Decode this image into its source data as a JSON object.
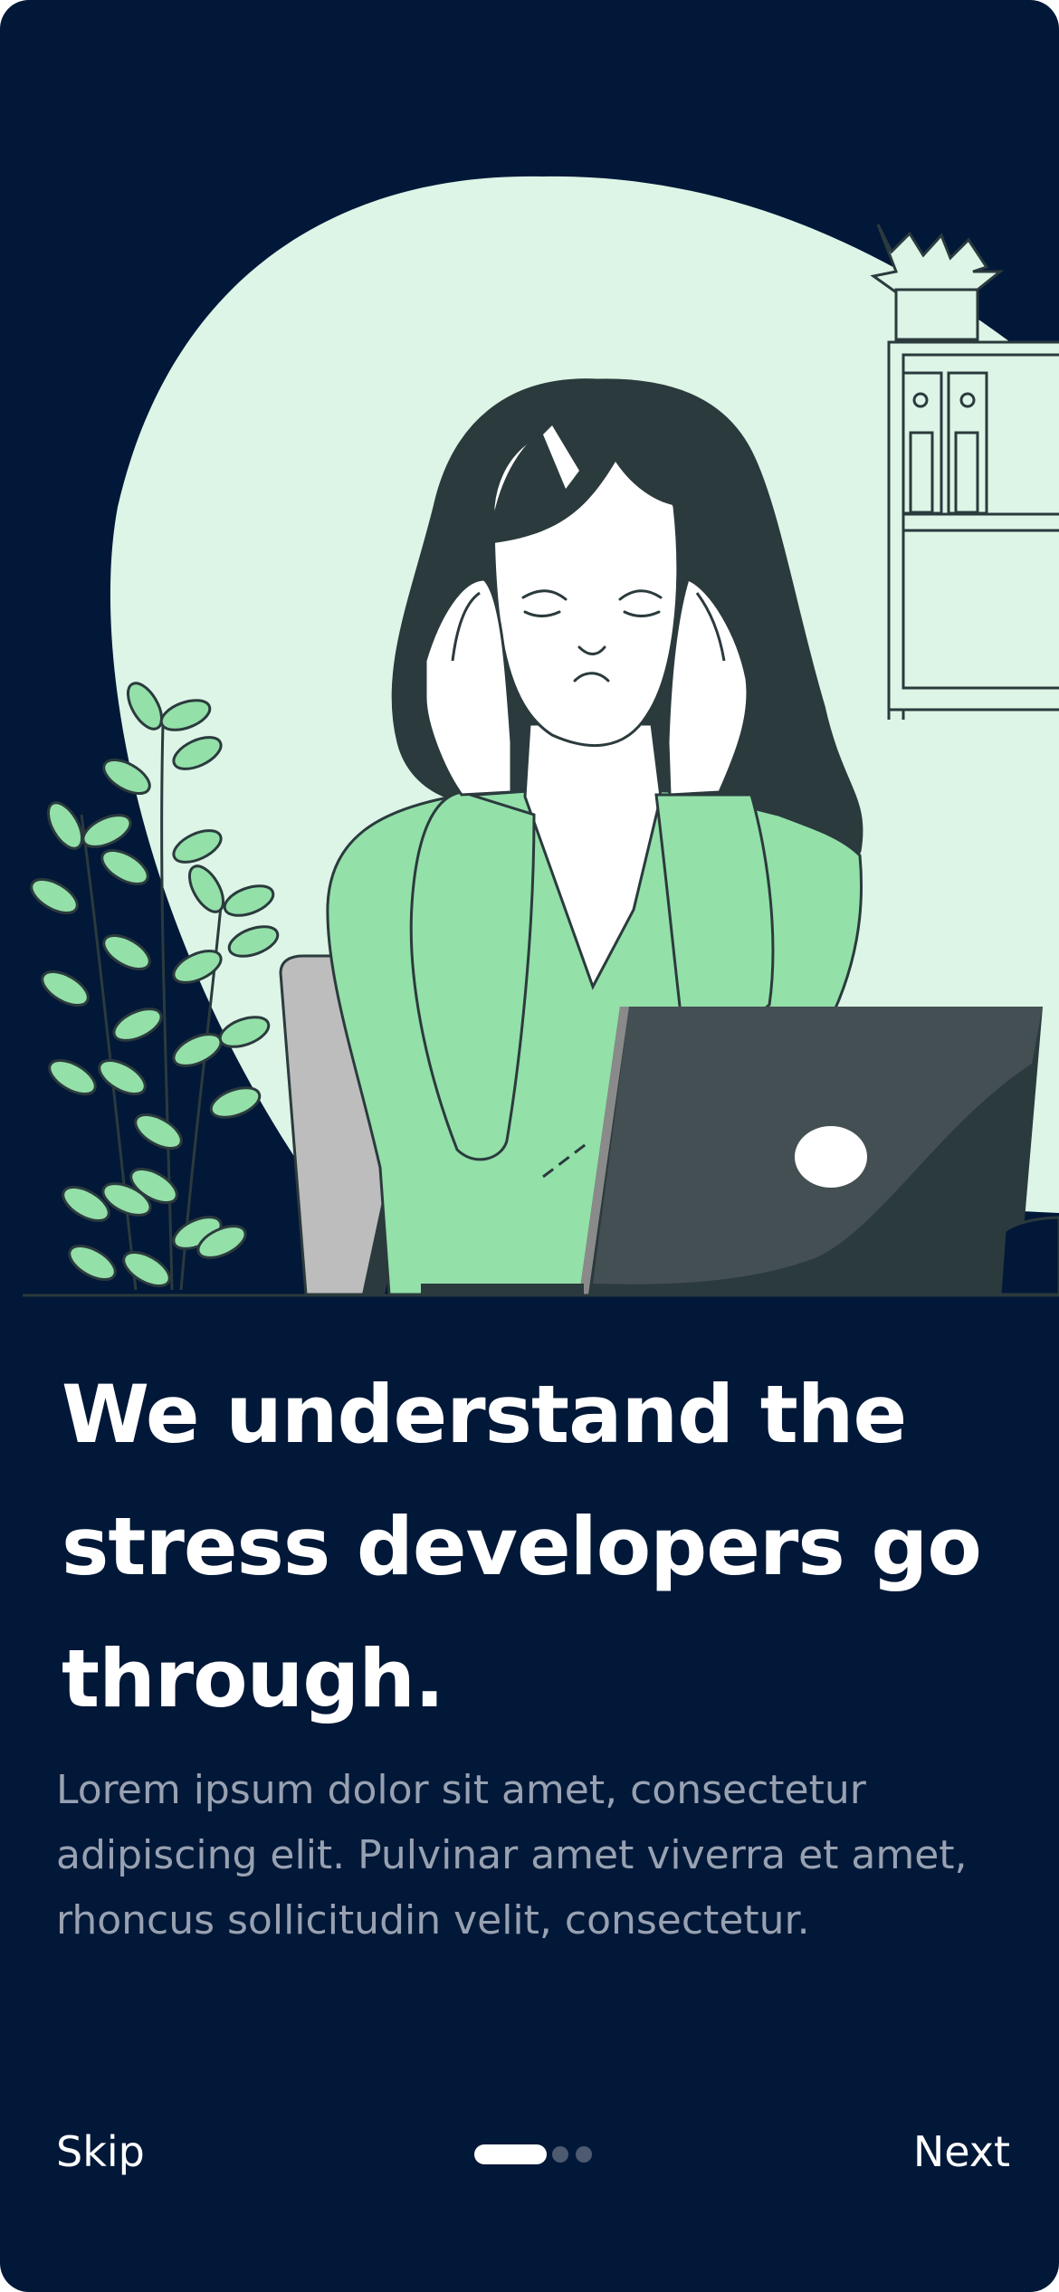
{
  "onboarding": {
    "headline": "We understand the stress developers go through.",
    "body": "Lorem ipsum dolor sit amet, consectetur adipiscing elit. Pulvinar amet viverra et amet, rhoncus sollicitudin velit, consectetur.",
    "skip_label": "Skip",
    "next_label": "Next",
    "page_indicator": {
      "current": 1,
      "total": 3
    }
  },
  "colors": {
    "background": "#021838",
    "blob": "#dcf5e6",
    "accent_green": "#93e0a9",
    "text_primary": "#ffffff",
    "text_secondary": "#98a1b1"
  },
  "icons": {
    "illustration": "stressed-woman-at-laptop-illustration"
  }
}
